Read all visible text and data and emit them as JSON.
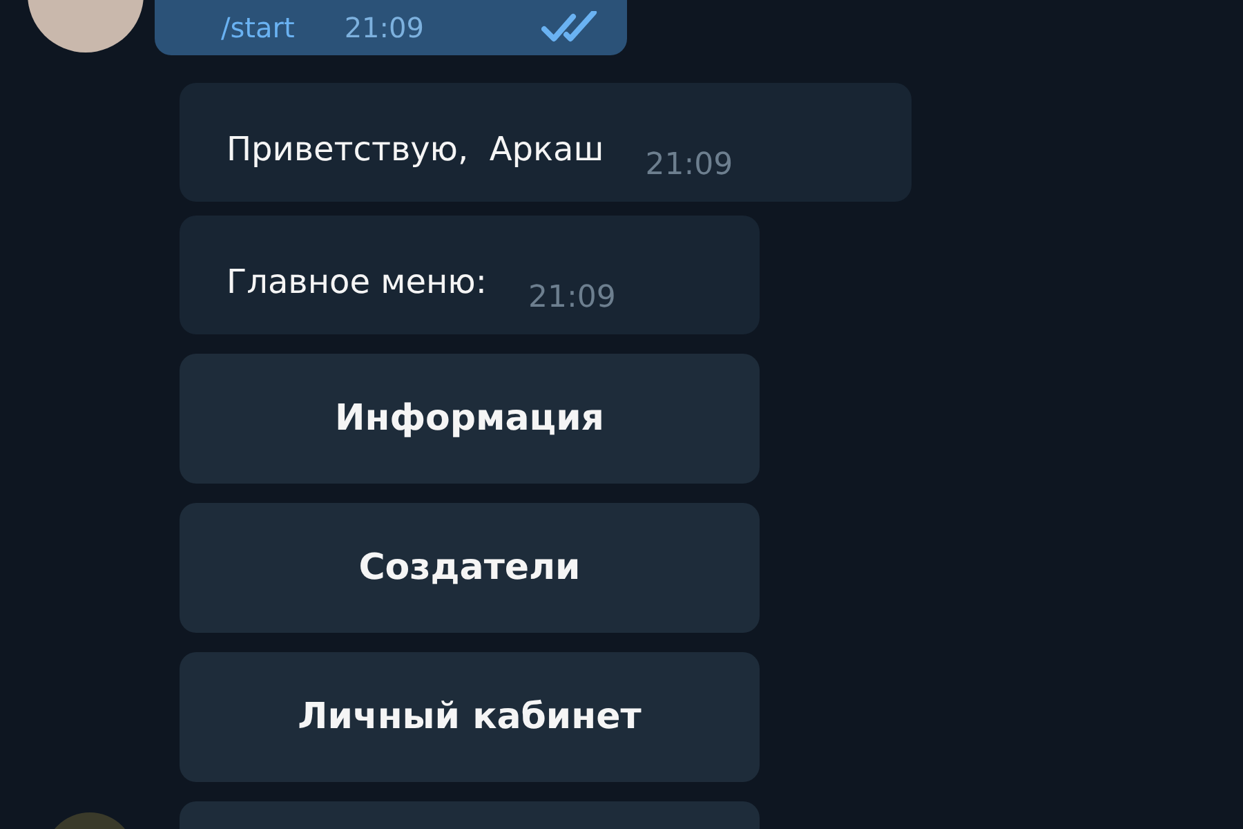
{
  "outgoing": {
    "text": "/start",
    "time": "21:09",
    "read": true
  },
  "messages": [
    {
      "text": "Приветствую,  Аркаш",
      "time": "21:09"
    },
    {
      "text": "Главное меню:",
      "time": "21:09"
    }
  ],
  "buttons": [
    "Информация",
    "Создатели",
    "Личный кабинет"
  ]
}
